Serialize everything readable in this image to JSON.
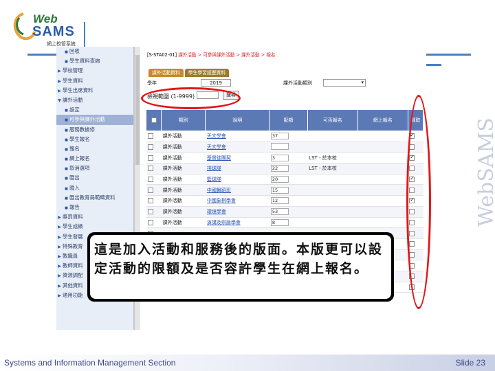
{
  "logo": {
    "web": "Web",
    "sams": "SAMS",
    "subtitle": "網上校管系統"
  },
  "watermark": "WebSAMS",
  "footer": {
    "left": "Systems and Information Management Section",
    "right": "Slide 23"
  },
  "sidebar": {
    "items": [
      {
        "label": "回收",
        "level": 1
      },
      {
        "label": "學生資料查詢",
        "level": 1
      },
      {
        "label": "學校管理",
        "level": 0
      },
      {
        "label": "學生資料",
        "level": 0
      },
      {
        "label": "學生出席資料",
        "level": 0
      },
      {
        "label": "課外活動",
        "level": 0,
        "open": true
      },
      {
        "label": "設定",
        "level": 1
      },
      {
        "label": "可參與課外活動",
        "level": 1,
        "active": true
      },
      {
        "label": "服務數據修",
        "level": 1
      },
      {
        "label": "學生報名",
        "level": 1
      },
      {
        "label": "報名",
        "level": 1
      },
      {
        "label": "網上報名",
        "level": 1
      },
      {
        "label": "取消選項",
        "level": 1
      },
      {
        "label": "匯出",
        "level": 1
      },
      {
        "label": "匯入",
        "level": 1
      },
      {
        "label": "匯出教育局範疇資料",
        "level": 1
      },
      {
        "label": "報告",
        "level": 1
      },
      {
        "label": "獎罰資料",
        "level": 0
      },
      {
        "label": "學生成績",
        "level": 0
      },
      {
        "label": "學生發展",
        "level": 0
      },
      {
        "label": "特殊教育",
        "level": 0
      },
      {
        "label": "教職員",
        "level": 0
      },
      {
        "label": "教師資料",
        "level": 0
      },
      {
        "label": "資源調配",
        "level": 0
      },
      {
        "label": "其他資料",
        "level": 0
      },
      {
        "label": "通用功能",
        "level": 0
      }
    ]
  },
  "content": {
    "breadcrumb": {
      "code": "[S-STA02-01]",
      "path": "課外活動 > 可參與課外活動 > 課外活動 > 報名"
    },
    "tabs": [
      "課外活動資料",
      "學生學習經歷資料"
    ],
    "filter": {
      "year_label": "學年",
      "year_value": "2019",
      "activity_label": "課外活動類別",
      "activity_value": ""
    },
    "range": {
      "label": "檢視範圍 (1-9999)",
      "search_label": "搜尋"
    },
    "columns": [
      "",
      "類別",
      "說明",
      "配額",
      "可否報名",
      "網上報名",
      "選取"
    ],
    "rows": [
      {
        "type": "課外活動",
        "desc": "天文學會",
        "quota": "37",
        "portal": "",
        "online": "",
        "sel": true
      },
      {
        "type": "課外活動",
        "desc": "天文學會",
        "quota": "",
        "portal": "",
        "online": "",
        "sel": false
      },
      {
        "type": "課外活動",
        "desc": "基督徒團契",
        "quota": "3",
        "portal": "LST - 於本校",
        "online": "",
        "sel": true
      },
      {
        "type": "課外活動",
        "desc": "排球隊",
        "quota": "22",
        "portal": "LST - 於本校",
        "online": "",
        "sel": false
      },
      {
        "type": "課外活動",
        "desc": "籃球隊",
        "quota": "20",
        "portal": "",
        "online": "",
        "sel": true
      },
      {
        "type": "課外活動",
        "desc": "中國舞蹈班",
        "quota": "15",
        "portal": "",
        "online": "",
        "sel": false
      },
      {
        "type": "課外活動",
        "desc": "中國象棋學會",
        "quota": "12",
        "portal": "",
        "online": "",
        "sel": true
      },
      {
        "type": "課外活動",
        "desc": "環境學會",
        "quota": "53",
        "portal": "",
        "online": "",
        "sel": false
      },
      {
        "type": "課外活動",
        "desc": "演講及辯論學會",
        "quota": "8",
        "portal": "",
        "online": "",
        "sel": false
      },
      {
        "type": "",
        "desc": "",
        "quota": "",
        "portal": "",
        "online": "",
        "sel": false
      },
      {
        "type": "",
        "desc": "",
        "quota": "",
        "portal": "",
        "online": "",
        "sel": false
      },
      {
        "type": "",
        "desc": "",
        "quota": "",
        "portal": "",
        "online": "",
        "sel": false
      },
      {
        "type": "",
        "desc": "",
        "quota": "",
        "portal": "",
        "online": "",
        "sel": false
      },
      {
        "type": "",
        "desc": "",
        "quota": "",
        "portal": "",
        "online": "",
        "sel": false
      },
      {
        "type": "",
        "desc": "",
        "quota": "",
        "portal": "",
        "online": "",
        "sel": false
      }
    ]
  },
  "callout": {
    "text": "這是加入活動和服務後的版面。本版更可以設定活動的限額及是否容許學生在網上報名。"
  },
  "colors": {
    "accent_rule": "#4a7fc0",
    "highlight": "#e01818",
    "table_header": "#5a79b5",
    "tab": "#c38b2c"
  }
}
